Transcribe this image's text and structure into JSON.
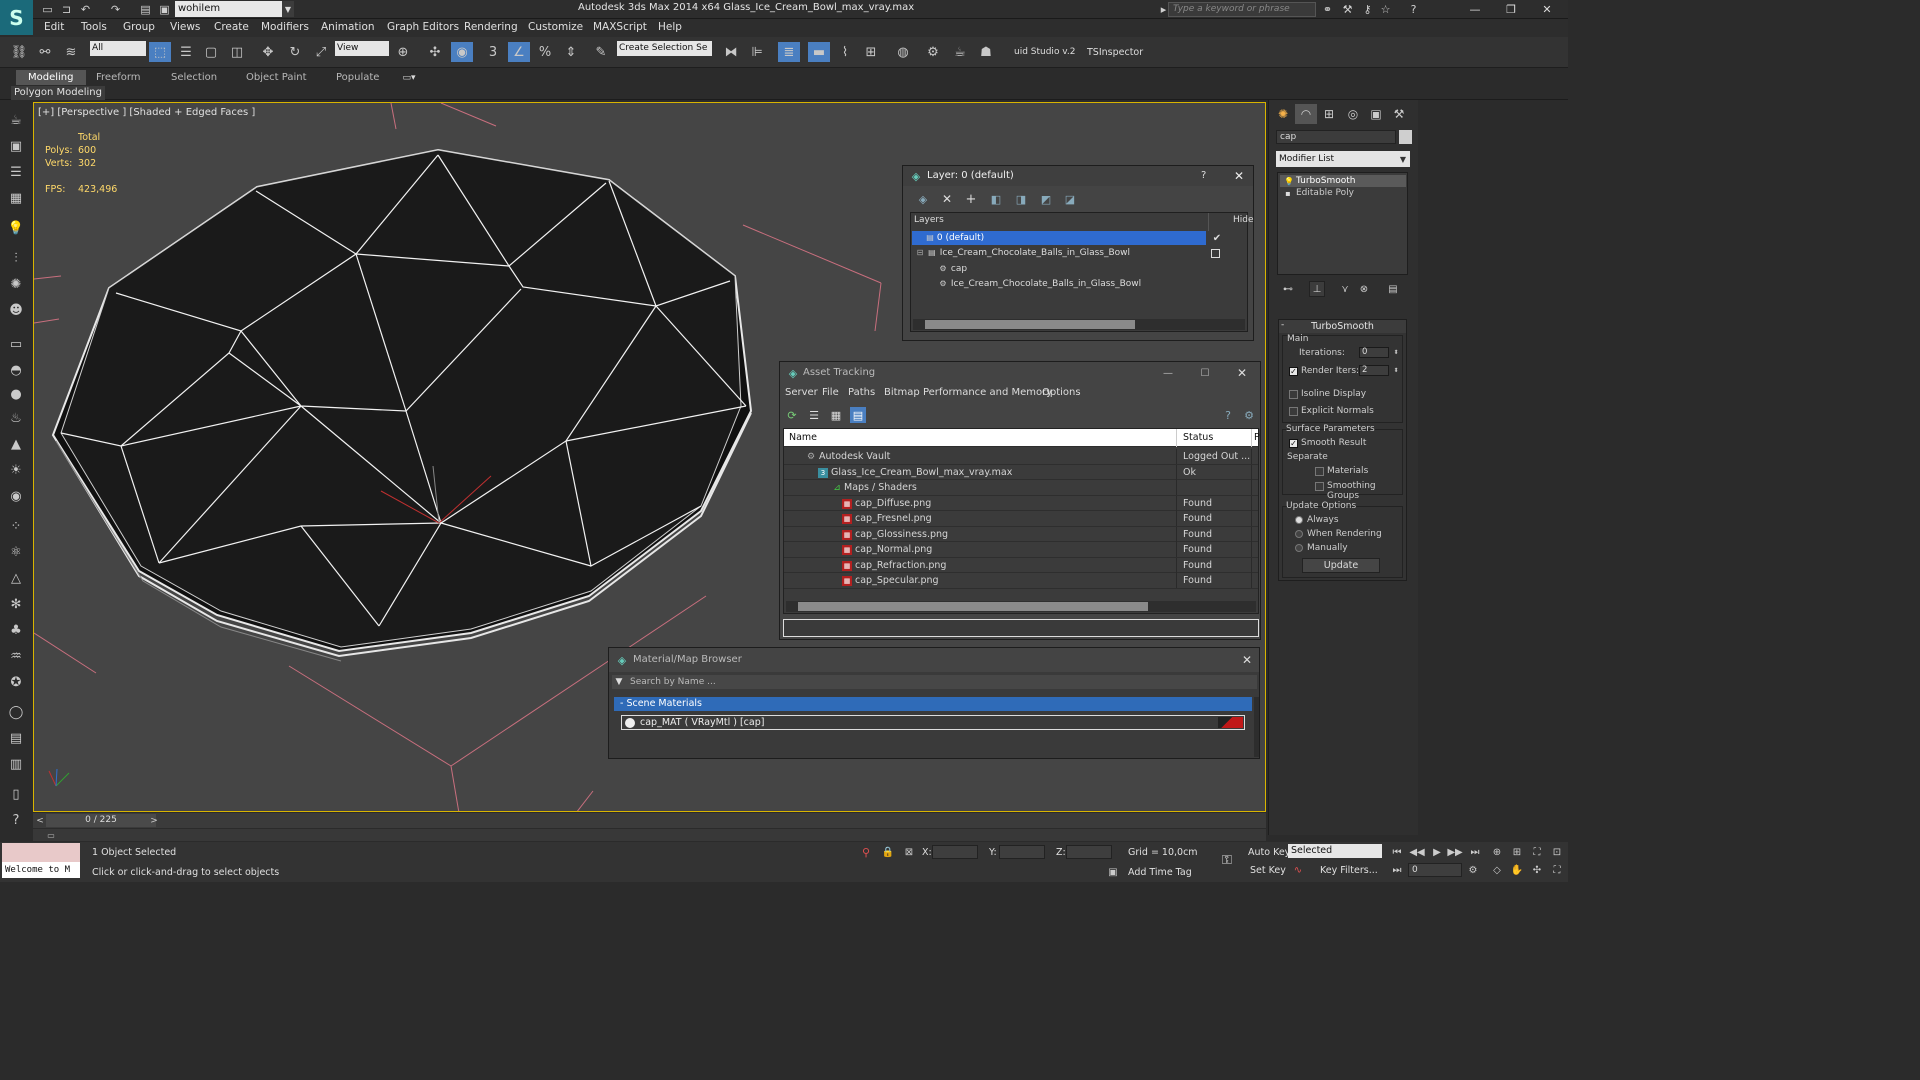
{
  "titlebar": {
    "workspace": "wohilem",
    "title": "Autodesk 3ds Max  2014 x64     Glass_Ice_Cream_Bowl_max_vray.max",
    "search_placeholder": "Type a keyword or phrase"
  },
  "menu": [
    "Edit",
    "Tools",
    "Group",
    "Views",
    "Create",
    "Modifiers",
    "Animation",
    "Graph Editors",
    "Rendering",
    "Customize",
    "MAXScript",
    "Help"
  ],
  "toolbar": {
    "filter": "All",
    "refcoord": "View",
    "selection_set": "Create Selection Se",
    "studio": "uid Studio v.2",
    "inspector": "TSInspector"
  },
  "ribbon": {
    "tabs": [
      "Modeling",
      "Freeform",
      "Selection",
      "Object Paint",
      "Populate"
    ],
    "panel": "Polygon Modeling"
  },
  "viewport": {
    "label": "[+] [Perspective ] [Shaded + Edged Faces ]",
    "stats": {
      "total_label": "Total",
      "polys_label": "Polys:",
      "polys": "600",
      "verts_label": "Verts:",
      "verts": "302",
      "fps_label": "FPS:",
      "fps": "423,496"
    }
  },
  "command_panel": {
    "object_name": "cap",
    "modifier_list": "Modifier List",
    "stack": [
      "TurboSmooth",
      "Editable Poly"
    ],
    "turbosmooth": {
      "title": "TurboSmooth",
      "main": "Main",
      "iterations_label": "Iterations:",
      "iterations": "0",
      "render_iters_label": "Render Iters:",
      "render_iters": "2",
      "isoline": "Isoline Display",
      "explicit": "Explicit Normals",
      "surface": "Surface Parameters",
      "smooth": "Smooth Result",
      "separate": "Separate",
      "materials": "Materials",
      "smoothing": "Smoothing Groups",
      "update_opts": "Update Options",
      "always": "Always",
      "when_rendering": "When Rendering",
      "manually": "Manually",
      "update": "Update"
    }
  },
  "layer_dialog": {
    "title": "Layer: 0 (default)",
    "help": "?",
    "col_layers": "Layers",
    "col_hide": "Hide",
    "rows": [
      "0 (default)",
      "Ice_Cream_Chocolate_Balls_in_Glass_Bowl",
      "cap",
      "Ice_Cream_Chocolate_Balls_in_Glass_Bowl"
    ]
  },
  "asset_dialog": {
    "title": "Asset Tracking",
    "menu": [
      "Server",
      "File",
      "Paths",
      "Bitmap Performance and Memory",
      "Options"
    ],
    "col_name": "Name",
    "col_status": "Status",
    "col_p": "P",
    "rows": [
      {
        "name": "Autodesk Vault",
        "status": "Logged Out ..."
      },
      {
        "name": "Glass_Ice_Cream_Bowl_max_vray.max",
        "status": "Ok"
      },
      {
        "name": "Maps / Shaders",
        "status": ""
      },
      {
        "name": "cap_Diffuse.png",
        "status": "Found"
      },
      {
        "name": "cap_Fresnel.png",
        "status": "Found"
      },
      {
        "name": "cap_Glossiness.png",
        "status": "Found"
      },
      {
        "name": "cap_Normal.png",
        "status": "Found"
      },
      {
        "name": "cap_Refraction.png",
        "status": "Found"
      },
      {
        "name": "cap_Specular.png",
        "status": "Found"
      }
    ]
  },
  "material_browser": {
    "title": "Material/Map Browser",
    "search": "Search by Name ...",
    "section": "- Scene Materials",
    "item": "cap_MAT  ( VRayMtl )  [cap]"
  },
  "timeline": {
    "frame": "0 / 225"
  },
  "status": {
    "maxscript": "Welcome to M",
    "selected": "1 Object Selected",
    "prompt": "Click or click-and-drag to select objects",
    "x": "X:",
    "y": "Y:",
    "z": "Z:",
    "grid": "Grid = 10,0cm",
    "add_time_tag": "Add Time Tag",
    "auto_key": "Auto Key",
    "set_key": "Set Key",
    "key_mode": "Selected",
    "key_filters": "Key Filters...",
    "frame_field": "0"
  }
}
